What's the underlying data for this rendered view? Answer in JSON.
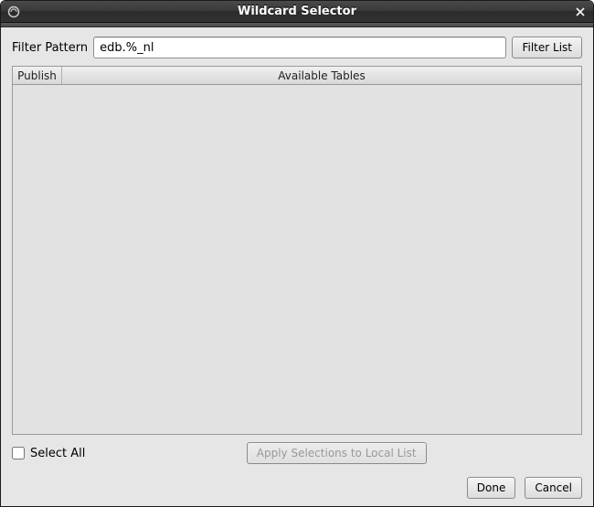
{
  "window": {
    "title": "Wildcard Selector"
  },
  "filter": {
    "label": "Filter Pattern",
    "value": "edb.%_nl",
    "button_label": "Filter List"
  },
  "table": {
    "headers": {
      "publish": "Publish",
      "available": "Available Tables"
    },
    "rows": []
  },
  "select_all": {
    "label": "Select All",
    "checked": false
  },
  "buttons": {
    "apply": "Apply Selections to Local List",
    "done": "Done",
    "cancel": "Cancel"
  }
}
